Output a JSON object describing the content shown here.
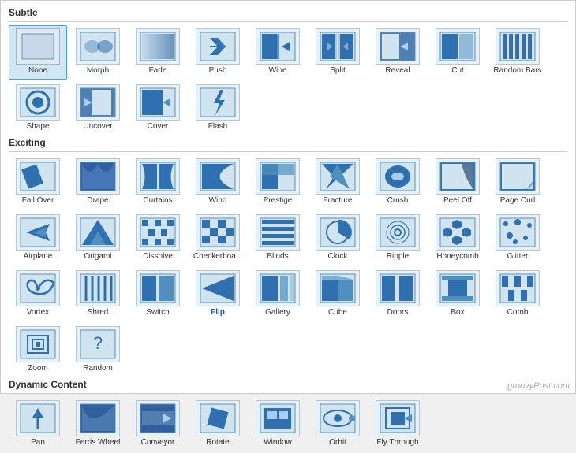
{
  "sections": [
    {
      "title": "Subtle",
      "items": [
        {
          "label": "None",
          "icon": "none"
        },
        {
          "label": "Morph",
          "icon": "morph"
        },
        {
          "label": "Fade",
          "icon": "fade"
        },
        {
          "label": "Push",
          "icon": "push"
        },
        {
          "label": "Wipe",
          "icon": "wipe"
        },
        {
          "label": "Split",
          "icon": "split"
        },
        {
          "label": "Reveal",
          "icon": "reveal"
        },
        {
          "label": "Cut",
          "icon": "cut"
        },
        {
          "label": "Random Bars",
          "icon": "randombars"
        },
        {
          "label": "Shape",
          "icon": "shape"
        },
        {
          "label": "Uncover",
          "icon": "uncover"
        },
        {
          "label": "Cover",
          "icon": "cover"
        },
        {
          "label": "Flash",
          "icon": "flash"
        }
      ]
    },
    {
      "title": "Exciting",
      "items": [
        {
          "label": "Fall Over",
          "icon": "fallover"
        },
        {
          "label": "Drape",
          "icon": "drape"
        },
        {
          "label": "Curtains",
          "icon": "curtains"
        },
        {
          "label": "Wind",
          "icon": "wind"
        },
        {
          "label": "Prestige",
          "icon": "prestige"
        },
        {
          "label": "Fracture",
          "icon": "fracture"
        },
        {
          "label": "Crush",
          "icon": "crush"
        },
        {
          "label": "Peel Off",
          "icon": "peeloff"
        },
        {
          "label": "Page Curl",
          "icon": "pagecurl"
        },
        {
          "label": "Airplane",
          "icon": "airplane"
        },
        {
          "label": "Origami",
          "icon": "origami"
        },
        {
          "label": "Dissolve",
          "icon": "dissolve"
        },
        {
          "label": "Checkerboa...",
          "icon": "checkerboard"
        },
        {
          "label": "Blinds",
          "icon": "blinds"
        },
        {
          "label": "Clock",
          "icon": "clock"
        },
        {
          "label": "Ripple",
          "icon": "ripple"
        },
        {
          "label": "Honeycomb",
          "icon": "honeycomb"
        },
        {
          "label": "Glitter",
          "icon": "glitter"
        },
        {
          "label": "Vortex",
          "icon": "vortex"
        },
        {
          "label": "Shred",
          "icon": "shred"
        },
        {
          "label": "Switch",
          "icon": "switch"
        },
        {
          "label": "Flip",
          "icon": "flip"
        },
        {
          "label": "Gallery",
          "icon": "gallery"
        },
        {
          "label": "Cube",
          "icon": "cube"
        },
        {
          "label": "Doors",
          "icon": "doors"
        },
        {
          "label": "Box",
          "icon": "box"
        },
        {
          "label": "Comb",
          "icon": "comb"
        },
        {
          "label": "Zoom",
          "icon": "zoom"
        },
        {
          "label": "Random",
          "icon": "random"
        }
      ]
    },
    {
      "title": "Dynamic Content",
      "items": [
        {
          "label": "Pan",
          "icon": "pan"
        },
        {
          "label": "Ferris Wheel",
          "icon": "ferriswheel"
        },
        {
          "label": "Conveyor",
          "icon": "conveyor"
        },
        {
          "label": "Rotate",
          "icon": "rotate"
        },
        {
          "label": "Window",
          "icon": "window"
        },
        {
          "label": "Orbit",
          "icon": "orbit"
        },
        {
          "label": "Fly Through",
          "icon": "flythrough"
        }
      ]
    }
  ],
  "watermark": "groovyPost.com"
}
